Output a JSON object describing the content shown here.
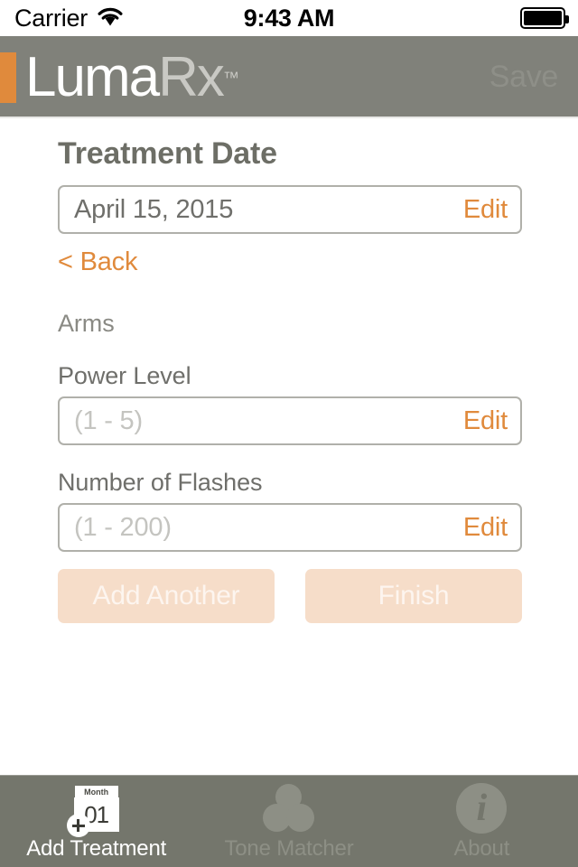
{
  "status_bar": {
    "carrier": "Carrier",
    "wifi_icon": "wifi-icon",
    "time": "9:43 AM",
    "battery_icon": "battery-full-icon"
  },
  "navbar": {
    "logo": {
      "primary": "Luma",
      "secondary": "Rx",
      "trademark": "™"
    },
    "save_label": "Save",
    "save_enabled": false
  },
  "main": {
    "page_title": "Treatment Date",
    "treatment_date": {
      "value": "April 15, 2015",
      "edit_label": "Edit"
    },
    "back_label": "< Back",
    "body_area": "Arms",
    "power_level": {
      "label": "Power Level",
      "value": "",
      "placeholder": "(1 - 5)",
      "edit_label": "Edit"
    },
    "number_of_flashes": {
      "label": "Number of Flashes",
      "value": "",
      "placeholder": "(1 - 200)",
      "edit_label": "Edit"
    },
    "add_another_label": "Add Another",
    "finish_label": "Finish"
  },
  "tabbar": {
    "tabs": [
      {
        "label": "Add Treatment",
        "icon": "calendar-plus-icon",
        "active": true
      },
      {
        "label": "Tone Matcher",
        "icon": "three-circles-icon",
        "active": false
      },
      {
        "label": "About",
        "icon": "info-circle-icon",
        "active": false
      }
    ],
    "calendar_icon": {
      "header": "Month",
      "day": "01"
    },
    "about_icon_glyph": "i"
  },
  "colors": {
    "accent_orange": "#e08a3c",
    "chrome_gray": "#80817a",
    "tabbar_gray": "#74766c",
    "disabled_button": "#f6ddc9",
    "field_border": "#b0b0aa",
    "text_gray": "#6f6f6b"
  }
}
